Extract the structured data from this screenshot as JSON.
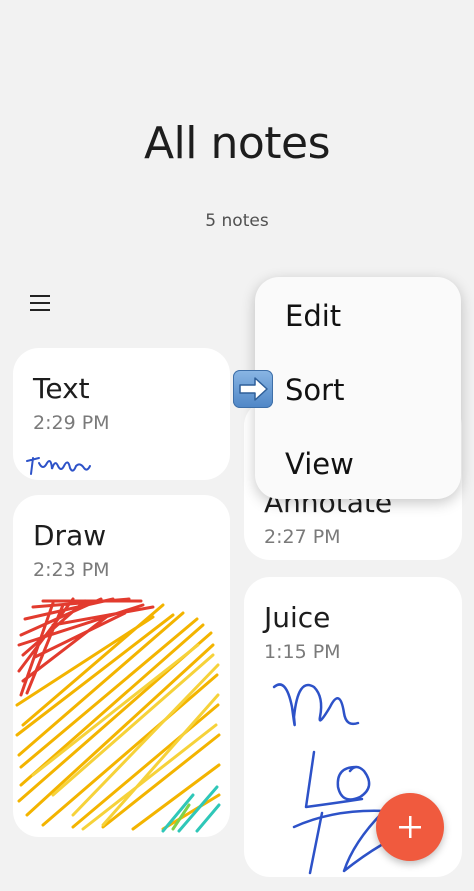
{
  "header": {
    "title": "All notes",
    "note_count": "5 notes"
  },
  "icons": {
    "menu": "hamburger-menu-icon",
    "arrow": "right-arrow-emoji-icon",
    "add": "plus-icon"
  },
  "notes": [
    {
      "title": "Text",
      "time": "2:29 PM",
      "preview": "handwriting-scribble"
    },
    {
      "title": "Draw",
      "time": "2:23 PM",
      "preview": "colored-scribble"
    },
    {
      "title": "Annotate",
      "time": "2:27 PM",
      "preview": ""
    },
    {
      "title": "Juice",
      "time": "1:15 PM",
      "preview": "handwriting-scribble"
    }
  ],
  "popup_menu": {
    "items": [
      "Edit",
      "Sort",
      "View"
    ]
  },
  "colors": {
    "background": "#f2f2f2",
    "card": "#ffffff",
    "fab": "#f05a3e",
    "ink_blue": "#2d52c8"
  }
}
